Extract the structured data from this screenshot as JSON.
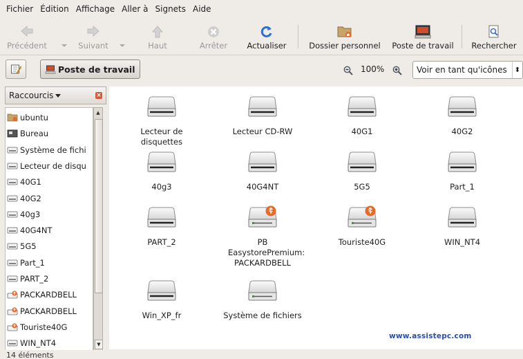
{
  "menubar": {
    "items": [
      {
        "label": "Fichier"
      },
      {
        "label": "Édition"
      },
      {
        "label": "Affichage"
      },
      {
        "label": "Aller à"
      },
      {
        "label": "Signets"
      },
      {
        "label": "Aide"
      }
    ]
  },
  "toolbar": {
    "back": "Précédent",
    "forward": "Suivant",
    "up": "Haut",
    "stop": "Arrêter",
    "reload": "Actualiser",
    "home": "Dossier personnel",
    "computer": "Poste de travail",
    "search": "Rechercher"
  },
  "location": {
    "crumb": "Poste de travail",
    "zoom": "100%",
    "view_mode": "Voir en tant qu'icônes"
  },
  "sidepane": {
    "title": "Raccourcis",
    "items": [
      {
        "label": "ubuntu",
        "icon": "home-folder-icon"
      },
      {
        "label": "Bureau",
        "icon": "desktop-icon"
      },
      {
        "label": "Système de fichi",
        "icon": "drive-icon"
      },
      {
        "label": "Lecteur de disqu",
        "icon": "drive-icon"
      },
      {
        "label": "40G1",
        "icon": "drive-icon"
      },
      {
        "label": "40G2",
        "icon": "drive-icon"
      },
      {
        "label": "40g3",
        "icon": "drive-icon"
      },
      {
        "label": "40G4NT",
        "icon": "drive-icon"
      },
      {
        "label": "5G5",
        "icon": "drive-icon"
      },
      {
        "label": "Part_1",
        "icon": "drive-icon"
      },
      {
        "label": "PART_2",
        "icon": "drive-icon"
      },
      {
        "label": "PACKARDBELL",
        "icon": "usb-drive-icon"
      },
      {
        "label": "PACKARDBELL",
        "icon": "usb-drive-icon"
      },
      {
        "label": "Touriste40G",
        "icon": "usb-drive-icon"
      },
      {
        "label": "WIN_NT4",
        "icon": "drive-icon"
      }
    ]
  },
  "drives": [
    {
      "label": "Lecteur de disquettes",
      "icon": "floppy-drive-icon"
    },
    {
      "label": "Lecteur CD-RW",
      "icon": "cdrom-drive-icon"
    },
    {
      "label": "40G1",
      "icon": "drive-icon"
    },
    {
      "label": "40G2",
      "icon": "drive-icon"
    },
    {
      "label": "40g3",
      "icon": "drive-icon"
    },
    {
      "label": "40G4NT",
      "icon": "drive-icon"
    },
    {
      "label": "5G5",
      "icon": "drive-icon"
    },
    {
      "label": "Part_1",
      "icon": "drive-icon"
    },
    {
      "label": "PART_2",
      "icon": "drive-icon"
    },
    {
      "label": "PB EasystorePremium: PACKARDBELL",
      "icon": "usb-drive-icon"
    },
    {
      "label": "Touriste40G",
      "icon": "usb-drive-icon"
    },
    {
      "label": "WIN_NT4",
      "icon": "drive-icon"
    },
    {
      "label": "Win_XP_fr",
      "icon": "drive-icon"
    },
    {
      "label": "Système de fichiers",
      "icon": "filesystem-drive-icon"
    }
  ],
  "watermark": "www.assistepc.com",
  "status": "14 éléments"
}
